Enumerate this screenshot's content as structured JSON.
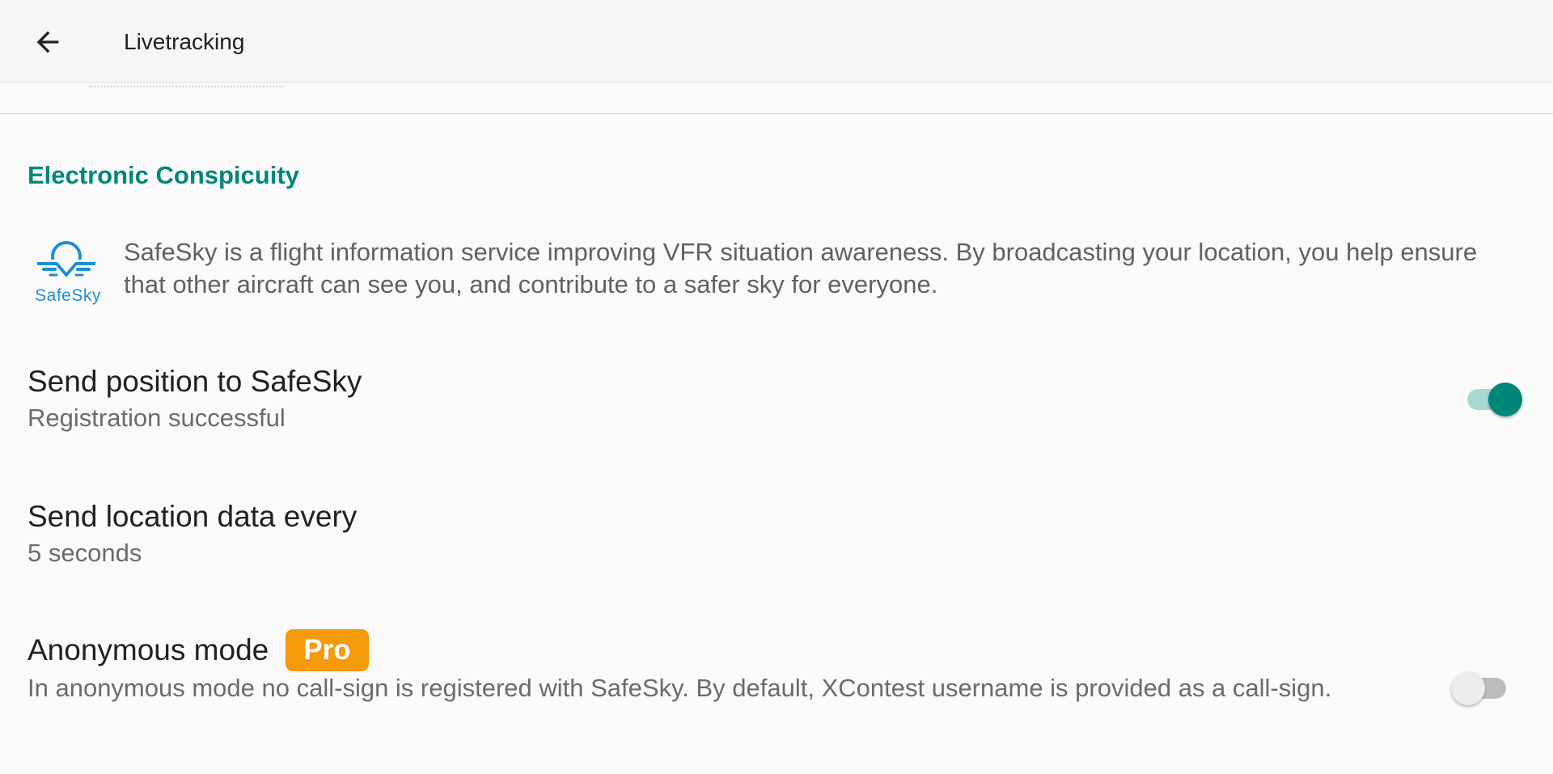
{
  "app_bar": {
    "title": "Livetracking",
    "back_icon": "arrow-left-icon"
  },
  "section": {
    "title": "Electronic Conspicuity"
  },
  "info": {
    "logo_text": "SafeSky",
    "logo_icon": "safesky-logo",
    "text": "SafeSky is a flight information service improving VFR situation awareness. By broadcasting your location, you help ensure that other aircraft can see you, and contribute to a safer sky for everyone."
  },
  "preferences": {
    "send_position": {
      "title": "Send position to SafeSky",
      "summary": "Registration successful",
      "enabled": true
    },
    "send_interval": {
      "title": "Send location data every",
      "summary": "5 seconds"
    },
    "anonymous_mode": {
      "title": "Anonymous mode",
      "badge": "Pro",
      "summary": "In anonymous mode no call-sign is registered with SafeSky. By default, XContest username is provided as a call-sign.",
      "enabled": false
    }
  },
  "colors": {
    "accent": "#00877a",
    "badge": "#f59a0a",
    "logo": "#1b8fd6"
  }
}
